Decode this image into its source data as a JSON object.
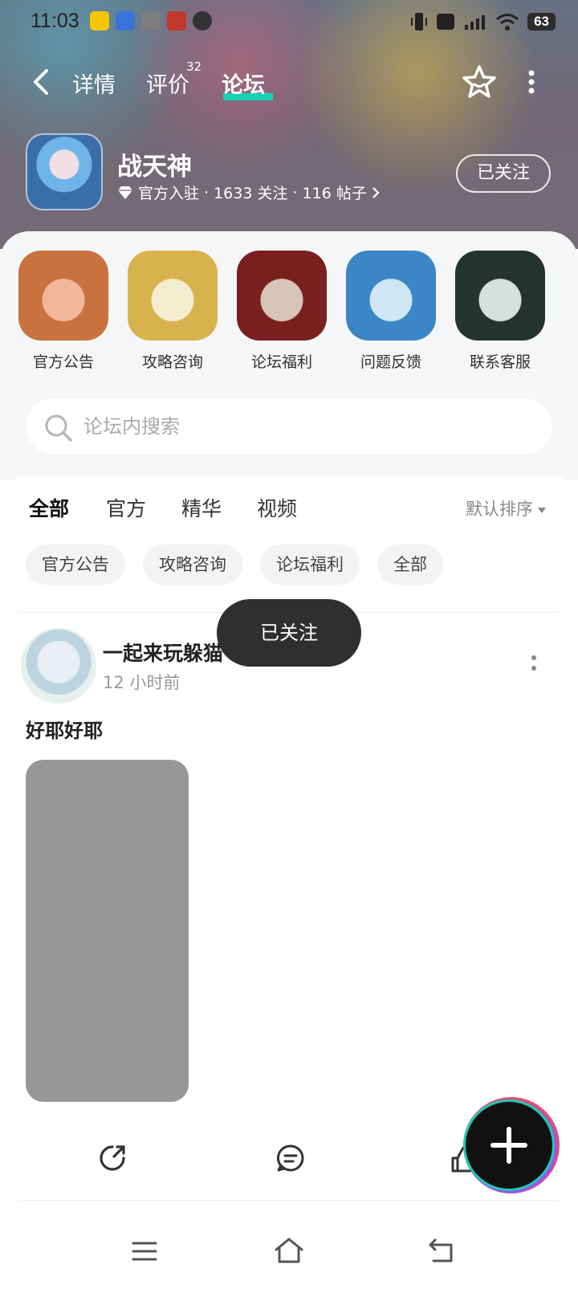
{
  "status_bar": {
    "time": "11:03",
    "battery": "63"
  },
  "nav": {
    "tabs": [
      {
        "label": "详情"
      },
      {
        "label": "评价",
        "badge": "32"
      },
      {
        "label": "论坛"
      }
    ]
  },
  "game": {
    "title": "战天神",
    "official": "官方入驻",
    "followers": "1633 关注",
    "posts": "116 帖子",
    "follow_label": "已关注"
  },
  "shortcuts": [
    {
      "label": "官方公告",
      "color_a": "#f0b79d",
      "color_b": "#c9723f"
    },
    {
      "label": "攻略咨询",
      "color_a": "#f4ecd1",
      "color_b": "#d8b24c"
    },
    {
      "label": "论坛福利",
      "color_a": "#d9c5b8",
      "color_b": "#7a1f20"
    },
    {
      "label": "问题反馈",
      "color_a": "#cfe7f5",
      "color_b": "#3b86c6"
    },
    {
      "label": "联系客服",
      "color_a": "#d7e0dc",
      "color_b": "#25332e"
    }
  ],
  "search": {
    "placeholder": "论坛内搜索"
  },
  "filter_tabs": [
    "全部",
    "官方",
    "精华",
    "视频"
  ],
  "sort_label": "默认排序",
  "chips": [
    "官方公告",
    "攻略咨询",
    "论坛福利",
    "全部"
  ],
  "post": {
    "author": "一起来玩躲猫",
    "time": "12 小时前",
    "text": "好耶好耶"
  },
  "toast": "已关注",
  "colors": {
    "accent": "#16d3b6",
    "image_placeholder": "#969898",
    "toast_bg": "#2f2f2f"
  }
}
